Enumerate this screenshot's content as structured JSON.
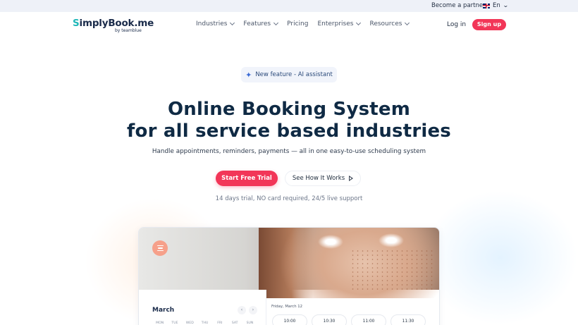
{
  "topbar": {
    "partner_label": "Become a partner",
    "language_label": "En"
  },
  "header": {
    "logo_text_prefix": "S",
    "logo_text_rest": "implyBook.me",
    "logo_by": "by teamblue",
    "nav": [
      {
        "label": "Industries",
        "has_dropdown": true
      },
      {
        "label": "Features",
        "has_dropdown": true
      },
      {
        "label": "Pricing",
        "has_dropdown": false
      },
      {
        "label": "Enterprises",
        "has_dropdown": true
      },
      {
        "label": "Resources",
        "has_dropdown": true
      }
    ],
    "login_label": "Log in",
    "signup_label": "Sign up"
  },
  "hero": {
    "feature_pill": "New feature - AI assistant",
    "headline_line1": "Online Booking System",
    "headline_line2": "for all service based industries",
    "subline": "Handle appointments, reminders, payments — all in one easy-to-use scheduling system",
    "cta_primary": "Start Free Trial",
    "cta_secondary": "See How It Works",
    "trial_note": "14 days trial, NO card required, 24/5 live support"
  },
  "preview": {
    "calendar_month": "March",
    "prev_arrow": "‹",
    "next_arrow": "›",
    "weekdays": [
      "MON",
      "TUE",
      "WED",
      "THU",
      "FRI",
      "SAT",
      "SUN"
    ],
    "slot_date": "Friday, March 12",
    "slots": [
      "10:00",
      "10:30",
      "11:00",
      "11:30"
    ]
  },
  "colors": {
    "accent": "#f23658",
    "brand_teal": "#1fb7b8",
    "navy": "#0f2a44"
  },
  "icons": {
    "feature": "sparkle-icon",
    "language": "uk-flag-icon",
    "secondary_cta": "play-icon",
    "preview_menu": "hamburger-menu-icon"
  }
}
